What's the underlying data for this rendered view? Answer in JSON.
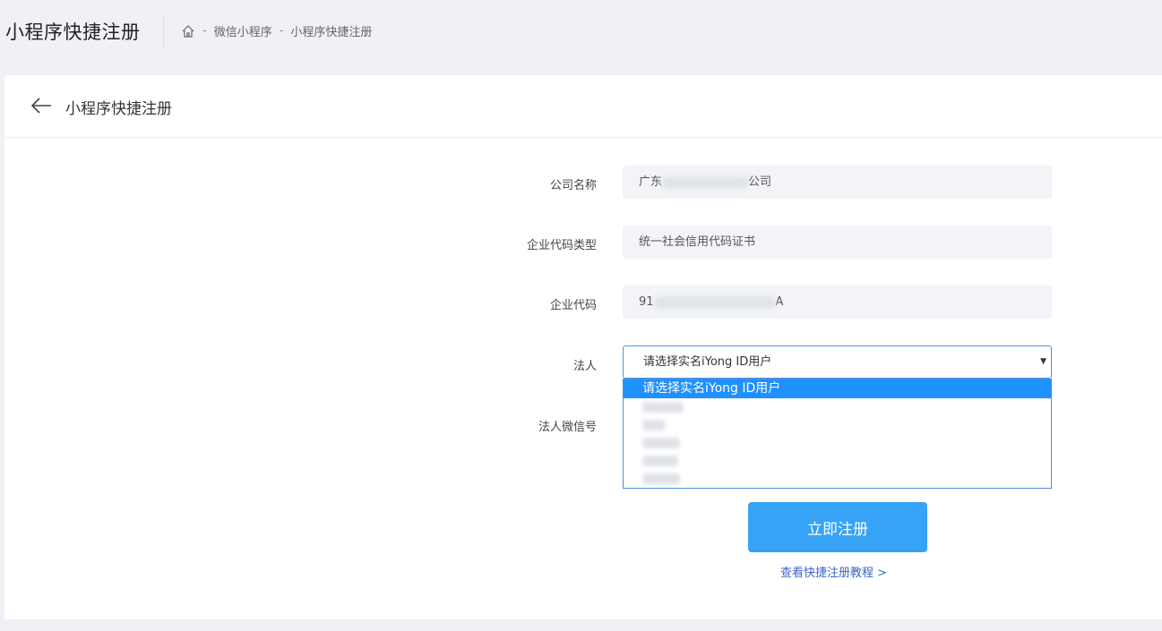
{
  "app_title": "小程序快捷注册",
  "breadcrumb": {
    "items": [
      "微信小程序",
      "小程序快捷注册"
    ],
    "separator": "-"
  },
  "card": {
    "title": "小程序快捷注册"
  },
  "form": {
    "company_name": {
      "label": "公司名称",
      "value_prefix": "广东",
      "value_suffix": "公司"
    },
    "code_type": {
      "label": "企业代码类型",
      "value": "统一社会信用代码证书"
    },
    "company_code": {
      "label": "企业代码",
      "value_prefix": "91",
      "value_suffix": "A"
    },
    "legal_person": {
      "label": "法人",
      "selected": "请选择实名iYong ID用户",
      "options_visible_count": 5
    },
    "legal_wechat": {
      "label": "法人微信号"
    }
  },
  "dropdown": {
    "highlighted_option": "请选择实名iYong ID用户"
  },
  "register_button": "立即注册",
  "tutorial_link": "查看快捷注册教程 >",
  "colors": {
    "accent": "#36a3f7",
    "select_highlight": "#1e90ff",
    "link": "#3a66c9",
    "field_bg": "#f3f4f8",
    "page_bg": "#f0f1f6"
  },
  "icons": {
    "home": "home-icon",
    "back": "back-arrow-icon",
    "dropdown": "caret-down-icon"
  }
}
